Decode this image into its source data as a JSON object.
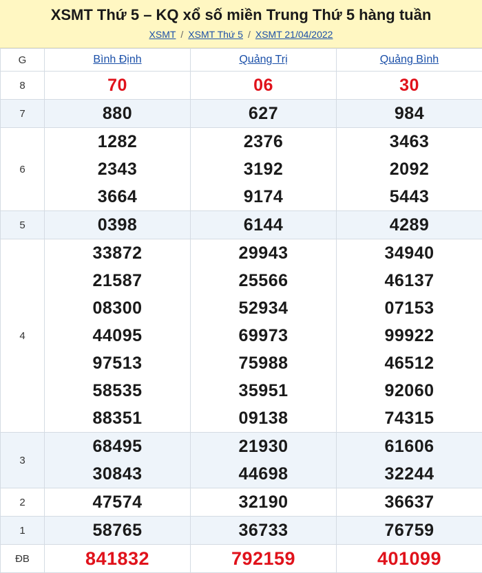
{
  "header": {
    "title": "XSMT Thứ 5 – KQ xổ số miền Trung Thứ 5 hàng tuần",
    "breadcrumb": [
      "XSMT",
      "XSMT Thứ 5",
      "XSMT 21/04/2022"
    ],
    "separator": "/"
  },
  "table": {
    "prize_header": "G",
    "provinces": [
      "Bình Định",
      "Quảng Trị",
      "Quảng Bình"
    ],
    "rows": [
      {
        "prize": "8",
        "values": [
          [
            "70"
          ],
          [
            "06"
          ],
          [
            "30"
          ]
        ],
        "style": "red",
        "alt": false
      },
      {
        "prize": "7",
        "values": [
          [
            "880"
          ],
          [
            "627"
          ],
          [
            "984"
          ]
        ],
        "style": "normal",
        "alt": true
      },
      {
        "prize": "6",
        "values": [
          [
            "1282",
            "2343",
            "3664"
          ],
          [
            "2376",
            "3192",
            "9174"
          ],
          [
            "3463",
            "2092",
            "5443"
          ]
        ],
        "style": "normal",
        "alt": false
      },
      {
        "prize": "5",
        "values": [
          [
            "0398"
          ],
          [
            "6144"
          ],
          [
            "4289"
          ]
        ],
        "style": "normal",
        "alt": true
      },
      {
        "prize": "4",
        "values": [
          [
            "33872",
            "21587",
            "08300",
            "44095",
            "97513",
            "58535",
            "88351"
          ],
          [
            "29943",
            "25566",
            "52934",
            "69973",
            "75988",
            "35951",
            "09138"
          ],
          [
            "34940",
            "46137",
            "07153",
            "99922",
            "46512",
            "92060",
            "74315"
          ]
        ],
        "style": "normal",
        "alt": false
      },
      {
        "prize": "3",
        "values": [
          [
            "68495",
            "30843"
          ],
          [
            "21930",
            "44698"
          ],
          [
            "61606",
            "32244"
          ]
        ],
        "style": "normal",
        "alt": true
      },
      {
        "prize": "2",
        "values": [
          [
            "47574"
          ],
          [
            "32190"
          ],
          [
            "36637"
          ]
        ],
        "style": "normal",
        "alt": false
      },
      {
        "prize": "1",
        "values": [
          [
            "58765"
          ],
          [
            "36733"
          ],
          [
            "76759"
          ]
        ],
        "style": "normal",
        "alt": true
      },
      {
        "prize": "ĐB",
        "values": [
          [
            "841832"
          ],
          [
            "792159"
          ],
          [
            "401099"
          ]
        ],
        "style": "red-big",
        "alt": false
      }
    ]
  },
  "colors": {
    "header_bg": "#fff7c2",
    "link": "#1a4fa8",
    "red_number": "#e0121b",
    "alt_row": "#eef4fa"
  }
}
